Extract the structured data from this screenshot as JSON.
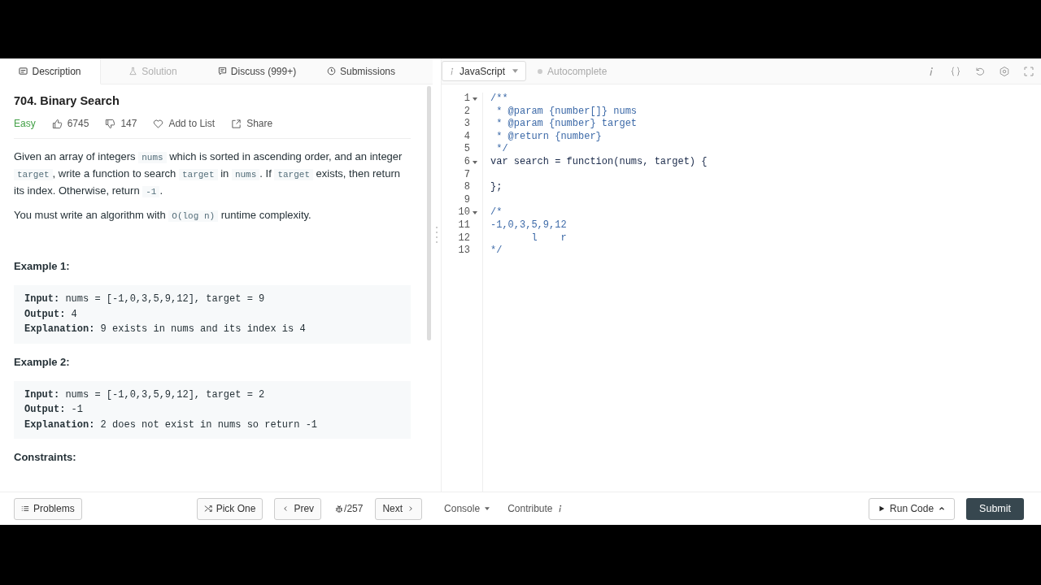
{
  "tabs": [
    {
      "label": "Description",
      "selected": true,
      "disabled": false
    },
    {
      "label": "Solution",
      "selected": false,
      "disabled": true
    },
    {
      "label": "Discuss (999+)",
      "selected": false,
      "disabled": false
    },
    {
      "label": "Submissions",
      "selected": false,
      "disabled": false
    }
  ],
  "problem": {
    "title": "704. Binary Search",
    "difficulty": "Easy",
    "likes": "6745",
    "dislikes": "147",
    "add_to_list": "Add to List",
    "share": "Share",
    "paragraphs": [
      [
        {
          "kind": "text",
          "t": "Given an array of integers "
        },
        {
          "kind": "code",
          "t": "nums"
        },
        {
          "kind": "text",
          "t": " which is sorted in ascending order, and an integer "
        },
        {
          "kind": "code",
          "t": "target"
        },
        {
          "kind": "text",
          "t": ", write a function to search "
        },
        {
          "kind": "code",
          "t": "target"
        },
        {
          "kind": "text",
          "t": " in "
        },
        {
          "kind": "code",
          "t": "nums"
        },
        {
          "kind": "text",
          "t": ". If "
        },
        {
          "kind": "code",
          "t": "target"
        },
        {
          "kind": "text",
          "t": " exists, then return its index. Otherwise, return "
        },
        {
          "kind": "code",
          "t": "-1"
        },
        {
          "kind": "text",
          "t": "."
        }
      ],
      [
        {
          "kind": "text",
          "t": "You must write an algorithm with "
        },
        {
          "kind": "code",
          "t": "O(log n)"
        },
        {
          "kind": "text",
          "t": " runtime complexity."
        }
      ]
    ],
    "examples": [
      {
        "title": "Example 1:",
        "lines": [
          "**Input:** nums = [-1,0,3,5,9,12], target = 9",
          "**Output:** 4",
          "**Explanation:** 9 exists in nums and its index is 4"
        ]
      },
      {
        "title": "Example 2:",
        "lines": [
          "**Input:** nums = [-1,0,3,5,9,12], target = 2",
          "**Output:** -1",
          "**Explanation:** 2 does not exist in nums so return -1"
        ]
      }
    ],
    "constraints_title": "Constraints:"
  },
  "editor": {
    "language": "JavaScript",
    "autocomplete": {
      "label": "Autocomplete",
      "on": false
    },
    "lines": [
      {
        "n": "1",
        "fold": true,
        "kind": "comment",
        "text": "/**"
      },
      {
        "n": "2",
        "fold": false,
        "kind": "comment",
        "text": " * @param {number[]} nums"
      },
      {
        "n": "3",
        "fold": false,
        "kind": "comment",
        "text": " * @param {number} target"
      },
      {
        "n": "4",
        "fold": false,
        "kind": "comment",
        "text": " * @return {number}"
      },
      {
        "n": "5",
        "fold": false,
        "kind": "comment",
        "text": " */"
      },
      {
        "n": "6",
        "fold": true,
        "kind": "code",
        "text": "var search = function(nums, target) {"
      },
      {
        "n": "7",
        "fold": false
      },
      {
        "n": "8",
        "fold": false,
        "kind": "code",
        "text": "};"
      },
      {
        "n": "9",
        "fold": false
      },
      {
        "n": "10",
        "fold": true,
        "kind": "comment",
        "text": "/*"
      },
      {
        "n": "11",
        "fold": false,
        "kind": "comment",
        "text": "-1,0,3,5,9,12"
      },
      {
        "n": "12",
        "fold": false,
        "kind": "comment",
        "text": "       l    r"
      },
      {
        "n": "13",
        "fold": false,
        "kind": "comment",
        "text": "*/"
      }
    ]
  },
  "footer": {
    "problems": "Problems",
    "pick_one": "Pick One",
    "prev": "Prev",
    "counter": "/257",
    "next": "Next",
    "console": "Console",
    "contribute": "Contribute",
    "run_code": "Run Code",
    "submit": "Submit"
  }
}
